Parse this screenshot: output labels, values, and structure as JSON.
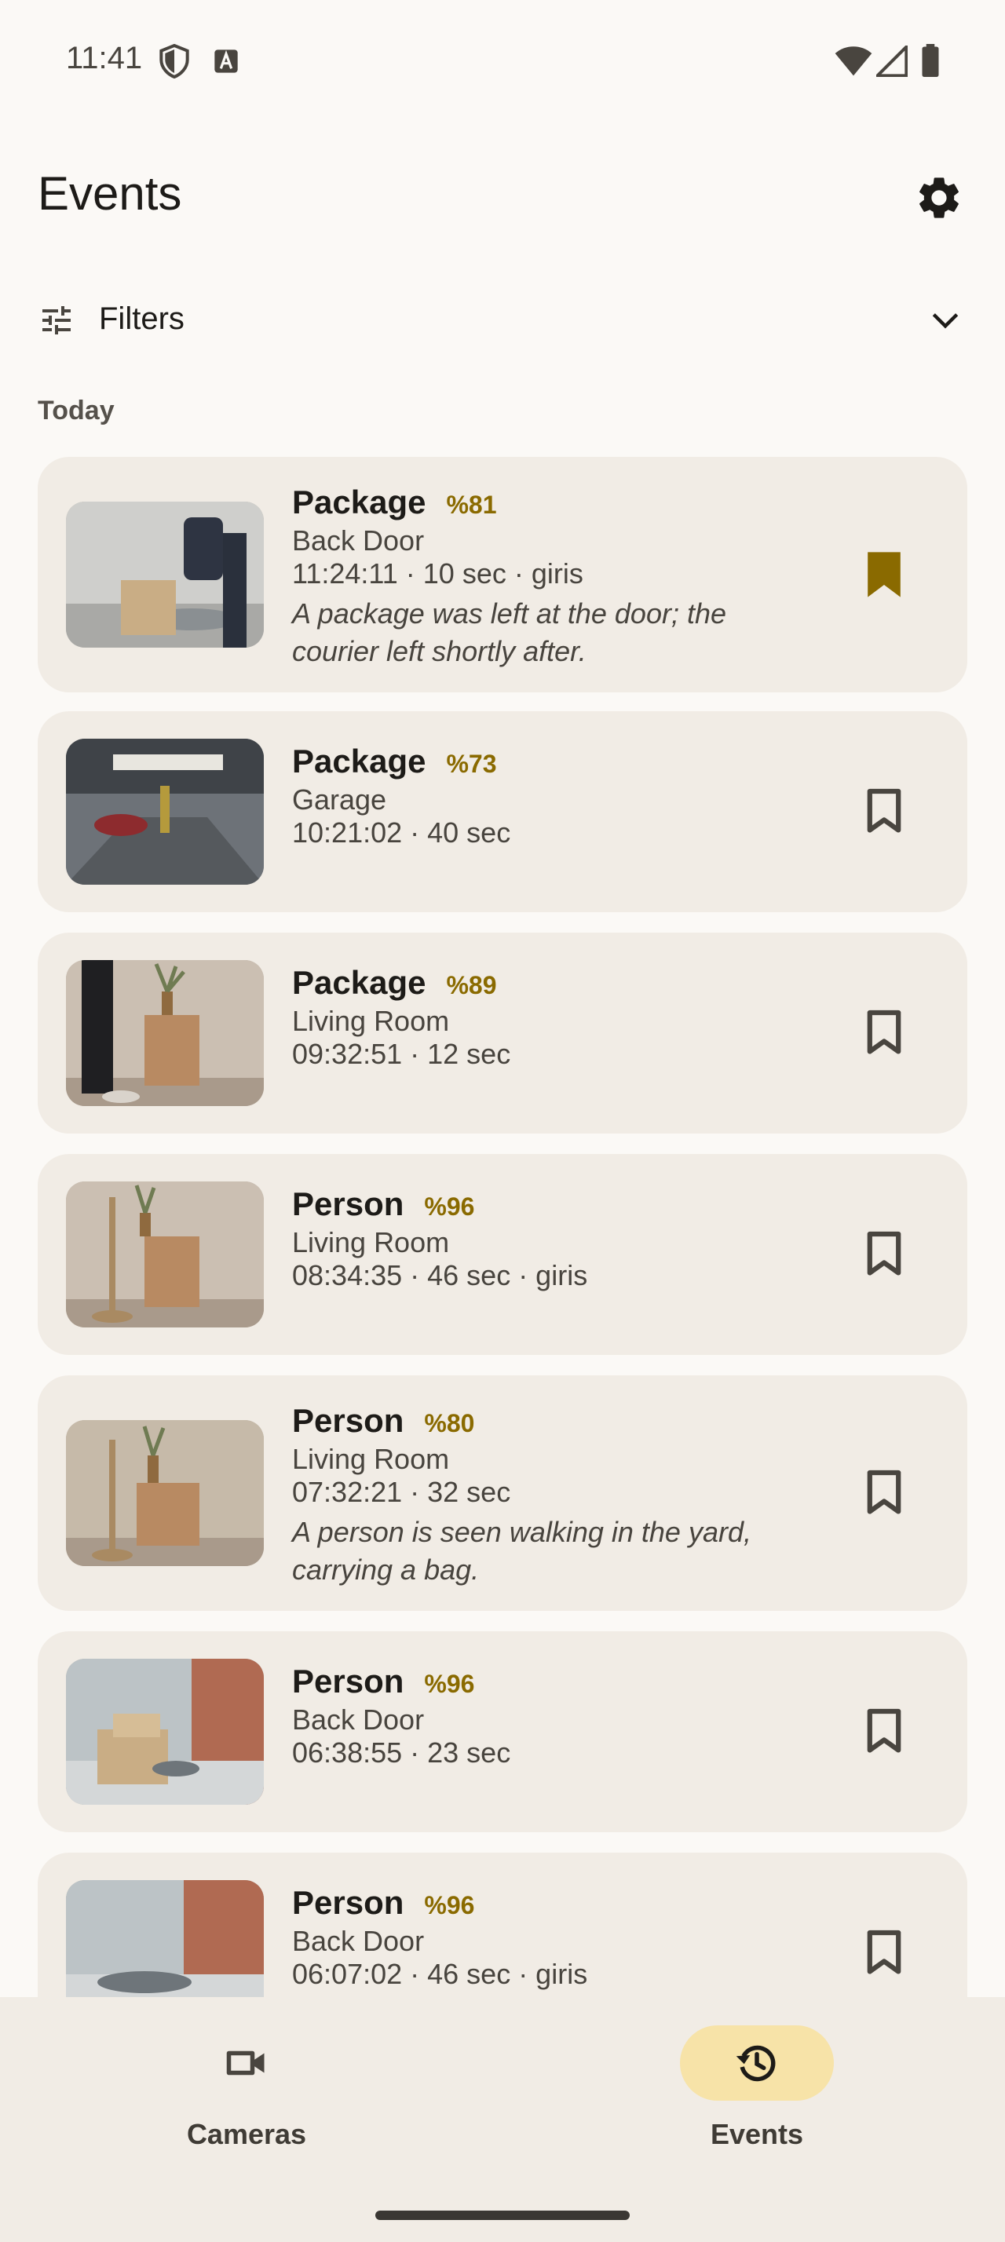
{
  "status_bar": {
    "time": "11:41"
  },
  "header": {
    "title": "Events"
  },
  "filters": {
    "label": "Filters"
  },
  "section": {
    "label": "Today"
  },
  "events": [
    {
      "type": "Package",
      "confidence": "%81",
      "camera": "Back Door",
      "meta": "11:24:11 · 10 sec · giris",
      "description": "A package was left at the door; the courier left shortly after.",
      "bookmarked": true
    },
    {
      "type": "Package",
      "confidence": "%73",
      "camera": "Garage",
      "meta": "10:21:02 · 40 sec",
      "description": "",
      "bookmarked": false
    },
    {
      "type": "Package",
      "confidence": "%89",
      "camera": "Living Room",
      "meta": "09:32:51 · 12 sec",
      "description": "",
      "bookmarked": false
    },
    {
      "type": "Person",
      "confidence": "%96",
      "camera": "Living Room",
      "meta": "08:34:35 · 46 sec · giris",
      "description": "",
      "bookmarked": false
    },
    {
      "type": "Person",
      "confidence": "%80",
      "camera": "Living Room",
      "meta": "07:32:21 · 32 sec",
      "description": "A person is seen walking in the yard, carrying a bag.",
      "bookmarked": false
    },
    {
      "type": "Person",
      "confidence": "%96",
      "camera": "Back Door",
      "meta": "06:38:55 · 23 sec",
      "description": "",
      "bookmarked": false
    },
    {
      "type": "Person",
      "confidence": "%96",
      "camera": "Back Door",
      "meta": "06:07:02 · 46 sec · giris",
      "description": "",
      "bookmarked": false
    }
  ],
  "nav": {
    "cameras_label": "Cameras",
    "events_label": "Events",
    "active": "events"
  },
  "colors": {
    "accent": "#8a6a00",
    "card": "#f1ece5",
    "active_pill": "#f7e3a8"
  }
}
